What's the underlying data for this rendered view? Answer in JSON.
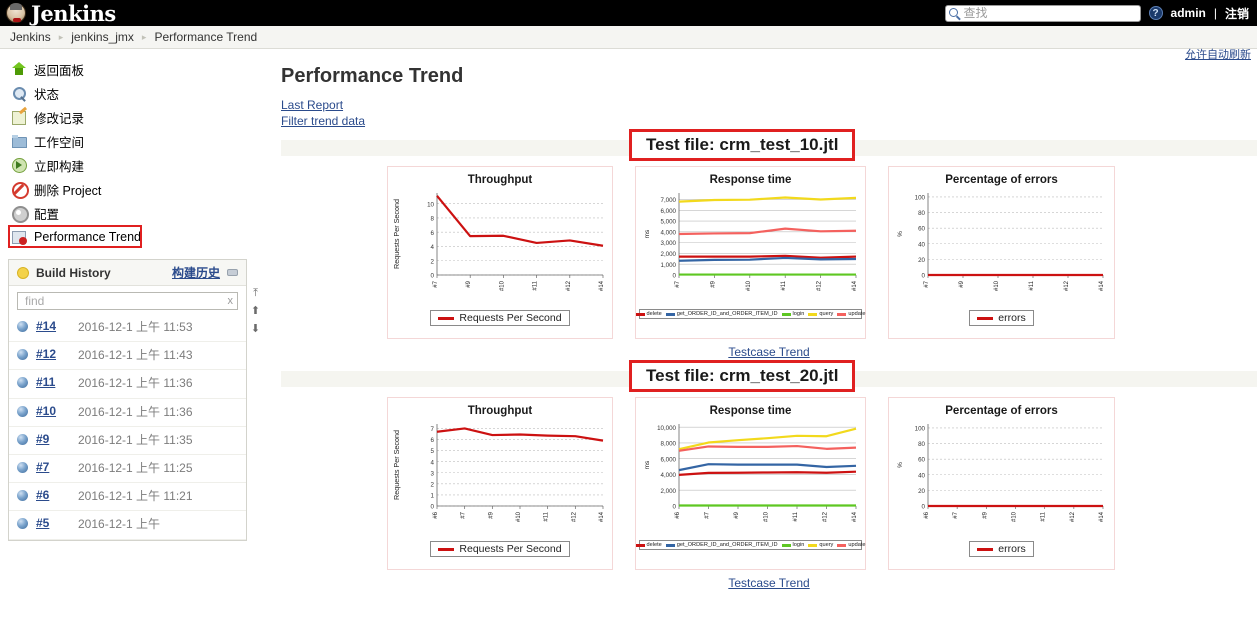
{
  "topbar": {
    "brand": "Jenkins",
    "search_placeholder": "查找",
    "search_value": "",
    "help_label": "?",
    "user": "admin",
    "separator": "|",
    "logout": "注销"
  },
  "breadcrumb": {
    "items": [
      "Jenkins",
      "jenkins_jmx",
      "Performance Trend"
    ],
    "separator": "▸",
    "autorefresh": "允许自动刷新"
  },
  "sidebar": {
    "items": [
      {
        "label": "返回面板",
        "icon": "up-arrow-icon"
      },
      {
        "label": "状态",
        "icon": "search-status-icon"
      },
      {
        "label": "修改记录",
        "icon": "changes-icon"
      },
      {
        "label": "工作空间",
        "icon": "folder-icon"
      },
      {
        "label": "立即构建",
        "icon": "build-now-icon"
      },
      {
        "label": "删除 Project",
        "icon": "delete-icon"
      },
      {
        "label": "配置",
        "icon": "gear-icon"
      },
      {
        "label": "Performance Trend",
        "icon": "performance-trend-icon"
      }
    ],
    "build_history": {
      "title": "Build History",
      "cn_link": "构建历史",
      "find_placeholder": "find",
      "find_value": "",
      "clear_label": "x",
      "scroll_top": "⤒",
      "scroll_up": "⬆",
      "scroll_down": "⬇",
      "builds": [
        {
          "number": "#14",
          "date": "2016-12-1 上午",
          "time": "11:53"
        },
        {
          "number": "#12",
          "date": "2016-12-1 上午",
          "time": "11:43"
        },
        {
          "number": "#11",
          "date": "2016-12-1 上午",
          "time": "11:36"
        },
        {
          "number": "#10",
          "date": "2016-12-1 上午",
          "time": "11:36"
        },
        {
          "number": "#9",
          "date": "2016-12-1 上午",
          "time": "11:35"
        },
        {
          "number": "#7",
          "date": "2016-12-1 上午",
          "time": "11:25"
        },
        {
          "number": "#6",
          "date": "2016-12-1 上午",
          "time": "11:21"
        },
        {
          "number": "#5",
          "date": "2016-12-1 上午",
          "time": ""
        }
      ]
    }
  },
  "main": {
    "title": "Performance Trend",
    "links": [
      "Last Report",
      "Filter trend data"
    ],
    "testcase_trend_label": "Testcase Trend",
    "sections": [
      {
        "testfile_label": "Test file: crm_test_10.jtl"
      },
      {
        "testfile_label": "Test file: crm_test_20.jtl"
      }
    ]
  },
  "colors": {
    "throughput": "#cc1111",
    "errors": "#cc1111",
    "delete": "#cc1111",
    "get_order": "#3465a4",
    "login": "#5ec722",
    "query": "#f2d91c",
    "update": "#f4615e",
    "annotation_red": "#e02020",
    "link_blue": "#2b4b8c"
  },
  "chart_data": [
    {
      "type": "line",
      "title": "Throughput",
      "section": "crm_test_10.jtl",
      "xlabel": "",
      "ylabel": "Requests Per Second",
      "categories": [
        "#7",
        "#9",
        "#10",
        "#11",
        "#12",
        "#14"
      ],
      "ylim": [
        0,
        11.5
      ],
      "yticks": [
        0,
        2,
        4,
        6,
        8,
        10
      ],
      "grid": true,
      "legend": [
        "Requests Per Second"
      ],
      "legend_position": "bottom",
      "series": [
        {
          "name": "Requests Per Second",
          "color": "#cc1111",
          "values": [
            11.1,
            5.45,
            5.5,
            4.5,
            4.85,
            4.1
          ]
        }
      ]
    },
    {
      "type": "line",
      "title": "Response time",
      "section": "crm_test_10.jtl",
      "xlabel": "",
      "ylabel": "ms",
      "categories": [
        "#7",
        "#9",
        "#10",
        "#11",
        "#12",
        "#14"
      ],
      "ylim": [
        0,
        7600
      ],
      "yticks": [
        0,
        1000,
        2000,
        3000,
        4000,
        5000,
        6000,
        7000
      ],
      "ytick_labels": [
        "0",
        "1,000",
        "2,000",
        "3,000",
        "4,000",
        "5,000",
        "6,000",
        "7,000"
      ],
      "grid": true,
      "legend_position": "bottom",
      "series": [
        {
          "name": "delete",
          "color": "#cc1111",
          "values": [
            1700,
            1700,
            1700,
            1780,
            1600,
            1700
          ]
        },
        {
          "name": "get_ORDER_ID_and_ORDER_ITEM_ID",
          "color": "#3465a4",
          "values": [
            1320,
            1400,
            1420,
            1580,
            1450,
            1480
          ]
        },
        {
          "name": "login",
          "color": "#5ec722",
          "values": [
            40,
            40,
            40,
            40,
            40,
            40
          ]
        },
        {
          "name": "query",
          "color": "#f2d91c",
          "values": [
            6800,
            6950,
            6980,
            7180,
            7000,
            7150
          ]
        },
        {
          "name": "update",
          "color": "#f4615e",
          "values": [
            3800,
            3850,
            3880,
            4300,
            4050,
            4100
          ]
        }
      ]
    },
    {
      "type": "line",
      "title": "Percentage of errors",
      "section": "crm_test_10.jtl",
      "xlabel": "",
      "ylabel": "%",
      "categories": [
        "#7",
        "#9",
        "#10",
        "#11",
        "#12",
        "#14"
      ],
      "ylim": [
        0,
        105
      ],
      "yticks": [
        0,
        20,
        40,
        60,
        80,
        100
      ],
      "grid": true,
      "legend": [
        "errors"
      ],
      "legend_position": "bottom",
      "series": [
        {
          "name": "errors",
          "color": "#cc1111",
          "values": [
            0,
            0,
            0,
            0,
            0,
            0
          ]
        }
      ]
    },
    {
      "type": "line",
      "title": "Throughput",
      "section": "crm_test_20.jtl",
      "xlabel": "",
      "ylabel": "Requests Per Second",
      "categories": [
        "#6",
        "#7",
        "#9",
        "#10",
        "#11",
        "#12",
        "#14"
      ],
      "ylim": [
        0,
        7.4
      ],
      "yticks": [
        0,
        1,
        2,
        3,
        4,
        5,
        6,
        7
      ],
      "grid": true,
      "legend": [
        "Requests Per Second"
      ],
      "legend_position": "bottom",
      "series": [
        {
          "name": "Requests Per Second",
          "color": "#cc1111",
          "values": [
            6.7,
            7.0,
            6.4,
            6.45,
            6.35,
            6.3,
            5.9
          ]
        }
      ]
    },
    {
      "type": "line",
      "title": "Response time",
      "section": "crm_test_20.jtl",
      "xlabel": "",
      "ylabel": "ms",
      "categories": [
        "#6",
        "#7",
        "#9",
        "#10",
        "#11",
        "#12",
        "#14"
      ],
      "ylim": [
        0,
        10400
      ],
      "yticks": [
        0,
        2000,
        4000,
        6000,
        8000,
        10000
      ],
      "ytick_labels": [
        "0",
        "2,000",
        "4,000",
        "6,000",
        "8,000",
        "10,000"
      ],
      "grid": true,
      "legend_position": "bottom",
      "series": [
        {
          "name": "delete",
          "color": "#cc1111",
          "values": [
            3950,
            4200,
            4220,
            4250,
            4280,
            4220,
            4350
          ]
        },
        {
          "name": "get_ORDER_ID_and_ORDER_ITEM_ID",
          "color": "#3465a4",
          "values": [
            4550,
            5300,
            5250,
            5250,
            5250,
            4950,
            5100
          ]
        },
        {
          "name": "login",
          "color": "#5ec722",
          "values": [
            60,
            60,
            60,
            60,
            60,
            60,
            60
          ]
        },
        {
          "name": "query",
          "color": "#f2d91c",
          "values": [
            7200,
            8050,
            8350,
            8600,
            8900,
            8850,
            9800
          ]
        },
        {
          "name": "update",
          "color": "#f4615e",
          "values": [
            7000,
            7550,
            7500,
            7500,
            7600,
            7250,
            7400
          ]
        }
      ]
    },
    {
      "type": "line",
      "title": "Percentage of errors",
      "section": "crm_test_20.jtl",
      "xlabel": "",
      "ylabel": "%",
      "categories": [
        "#6",
        "#7",
        "#9",
        "#10",
        "#11",
        "#12",
        "#14"
      ],
      "ylim": [
        0,
        105
      ],
      "yticks": [
        0,
        20,
        40,
        60,
        80,
        100
      ],
      "grid": true,
      "legend": [
        "errors"
      ],
      "legend_position": "bottom",
      "series": [
        {
          "name": "errors",
          "color": "#cc1111",
          "values": [
            0,
            0,
            0,
            0,
            0,
            0,
            0
          ]
        }
      ]
    }
  ]
}
